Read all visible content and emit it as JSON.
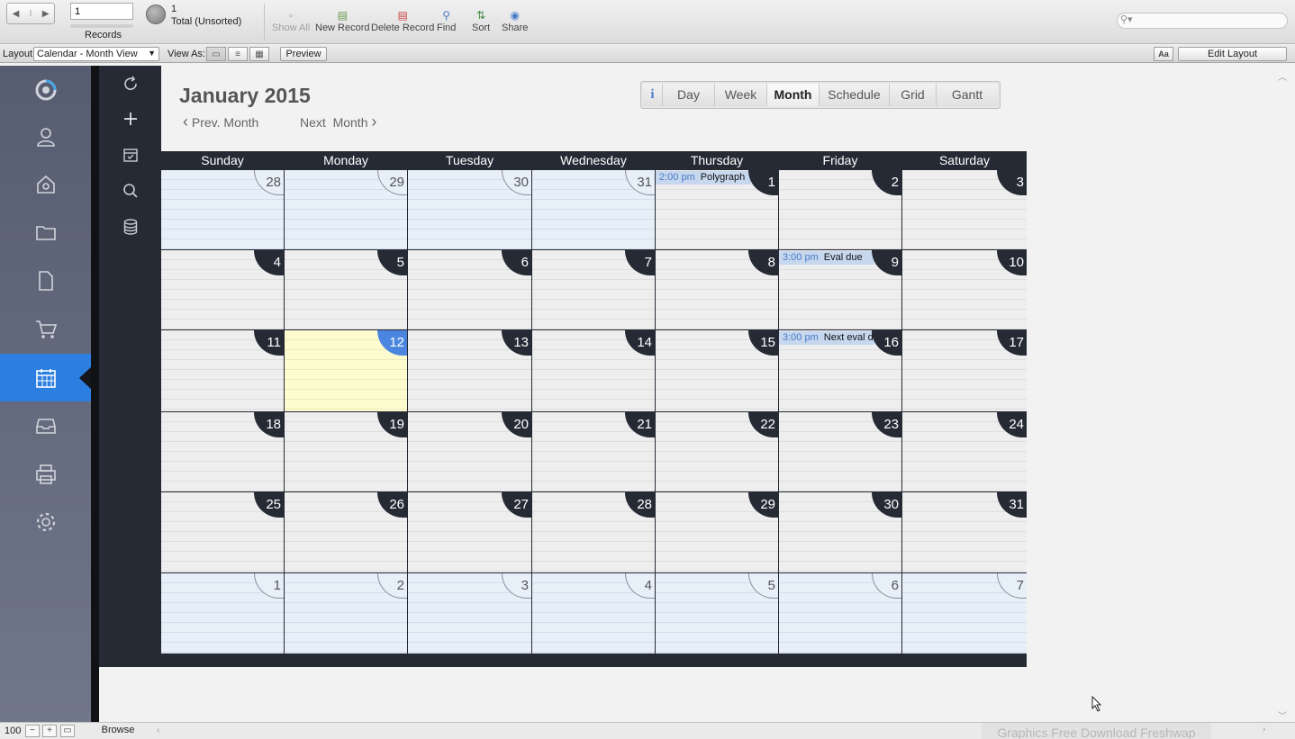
{
  "toolbar": {
    "record_value": "1",
    "records_label": "Records",
    "found_count": "1",
    "found_status": "Total (Unsorted)",
    "buttons": {
      "show_all": "Show All",
      "new_record": "New Record",
      "delete_record": "Delete Record",
      "find": "Find",
      "sort": "Sort",
      "share": "Share"
    }
  },
  "layoutbar": {
    "layout_label": "Layout:",
    "layout_value": "Calendar - Month View",
    "view_as_label": "View As:",
    "preview_label": "Preview",
    "aa_label": "Aa",
    "edit_layout_label": "Edit Layout"
  },
  "calendar": {
    "title": "January 2015",
    "prev_label": "Prev. Month",
    "next_label": "Next  Month",
    "view_tabs": [
      "i",
      "Day",
      "Week",
      "Month",
      "Schedule",
      "Grid",
      "Gantt"
    ],
    "active_tab": "Month",
    "weekdays": [
      "Sunday",
      "Monday",
      "Tuesday",
      "Wednesday",
      "Thursday",
      "Friday",
      "Saturday"
    ],
    "weeks": [
      [
        "28",
        "29",
        "30",
        "31",
        "1",
        "2",
        "3"
      ],
      [
        "4",
        "5",
        "6",
        "7",
        "8",
        "9",
        "10"
      ],
      [
        "11",
        "12",
        "13",
        "14",
        "15",
        "16",
        "17"
      ],
      [
        "18",
        "19",
        "20",
        "21",
        "22",
        "23",
        "24"
      ],
      [
        "25",
        "26",
        "27",
        "28",
        "29",
        "30",
        "31"
      ],
      [
        "1",
        "2",
        "3",
        "4",
        "5",
        "6",
        "7"
      ]
    ],
    "events": [
      {
        "week": 0,
        "day": 4,
        "time": "2:00 pm",
        "title": "Polygraph"
      },
      {
        "week": 1,
        "day": 5,
        "time": "3:00 pm",
        "title": "Eval due"
      },
      {
        "week": 2,
        "day": 5,
        "time": "3:00 pm",
        "title": "Next eval d"
      }
    ],
    "today": {
      "week": 2,
      "day": 1
    }
  },
  "statusbar": {
    "zoom": "100",
    "mode": "Browse"
  },
  "watermark": "Graphics Free Download Freshwap",
  "colors": {
    "sidebar_active": "#2c7ee0",
    "calendar_dark": "#262a35",
    "today_fill": "#fdfbd0",
    "today_badge": "#4a86e0",
    "event_fill": "#c6d7ee",
    "out_of_month_fill": "#e7eff9"
  }
}
